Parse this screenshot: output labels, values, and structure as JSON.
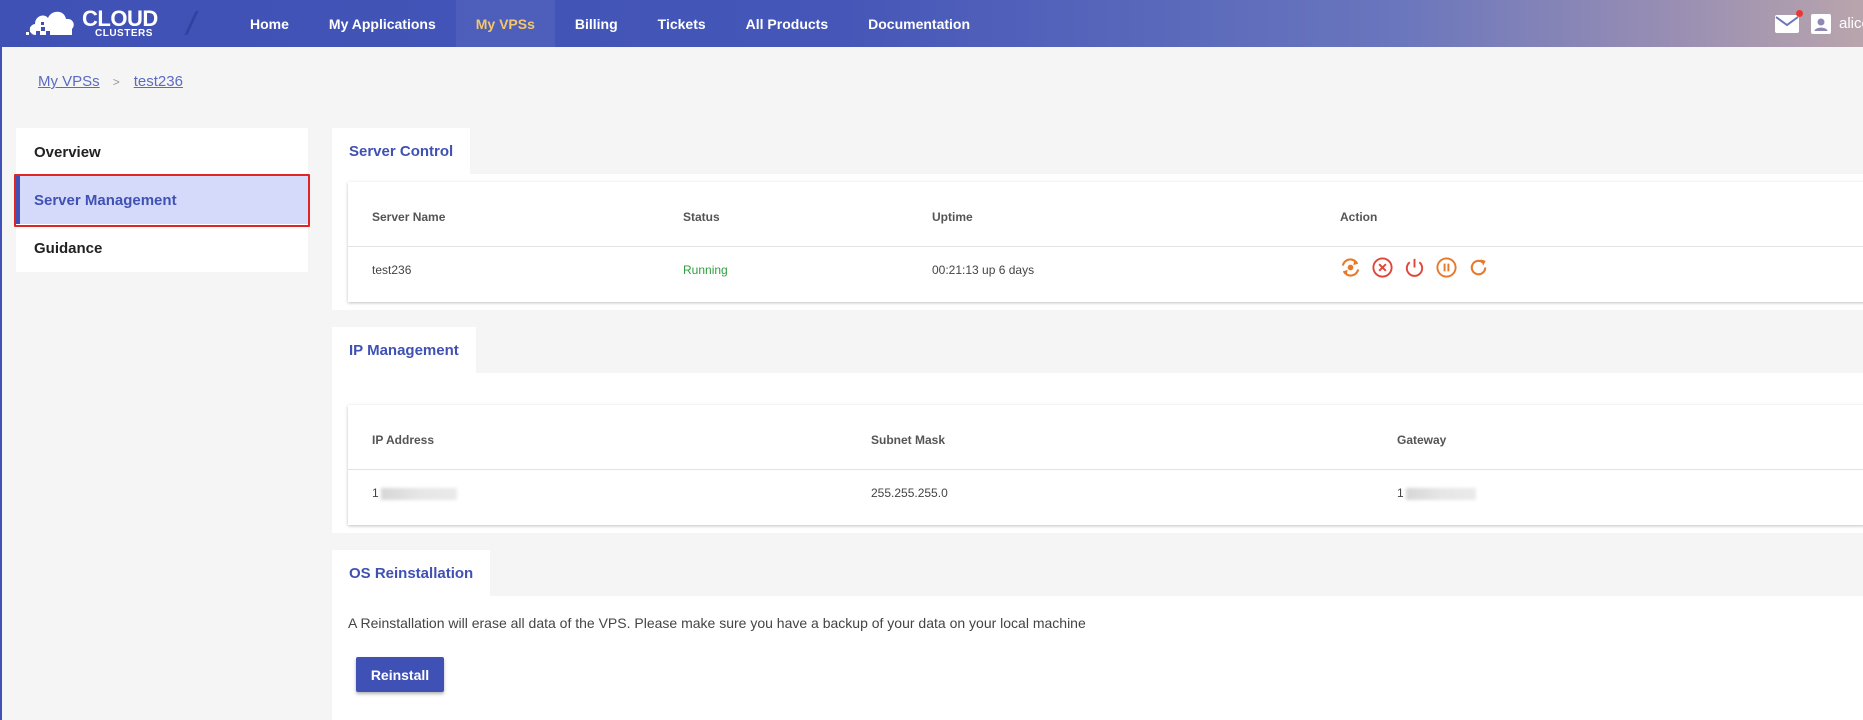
{
  "header": {
    "logo_line1": "CLOUD",
    "logo_line2": "CLUSTERS",
    "nav": [
      {
        "label": "Home"
      },
      {
        "label": "My Applications"
      },
      {
        "label": "My VPSs"
      },
      {
        "label": "Billing"
      },
      {
        "label": "Tickets"
      },
      {
        "label": "All Products"
      },
      {
        "label": "Documentation"
      }
    ],
    "active_nav": "My VPSs",
    "username": "alice",
    "has_notification": true
  },
  "breadcrumb": {
    "parent": "My VPSs",
    "separator": ">",
    "current": "test236"
  },
  "sidebar": {
    "items": [
      {
        "label": "Overview"
      },
      {
        "label": "Server Management"
      },
      {
        "label": "Guidance"
      }
    ],
    "active": "Server Management"
  },
  "server_control": {
    "tab": "Server Control",
    "columns": [
      "Server Name",
      "Status",
      "Uptime",
      "Action"
    ],
    "row": {
      "server_name": "test236",
      "status": "Running",
      "uptime": "00:21:13 up 6 days"
    },
    "actions": [
      "rebuild-icon",
      "stop-icon",
      "power-icon",
      "pause-icon",
      "restart-icon"
    ]
  },
  "ip_management": {
    "tab": "IP Management",
    "columns": [
      "IP Address",
      "Subnet Mask",
      "Gateway"
    ],
    "row": {
      "ip_address_visible": "1",
      "subnet_mask": "255.255.255.0",
      "gateway_visible": "1"
    }
  },
  "os_reinstallation": {
    "tab": "OS Reinstallation",
    "note": "A Reinstallation will erase all data of the VPS. Please make sure you have a backup of your data on your local machine",
    "button": "Reinstall"
  },
  "colors": {
    "primary": "#3f51b5",
    "active_nav": "#f4c76a",
    "running": "#2e9e3e",
    "action_orange": "#e8792b",
    "action_red": "#e0473a",
    "highlight_border": "#e02424"
  }
}
